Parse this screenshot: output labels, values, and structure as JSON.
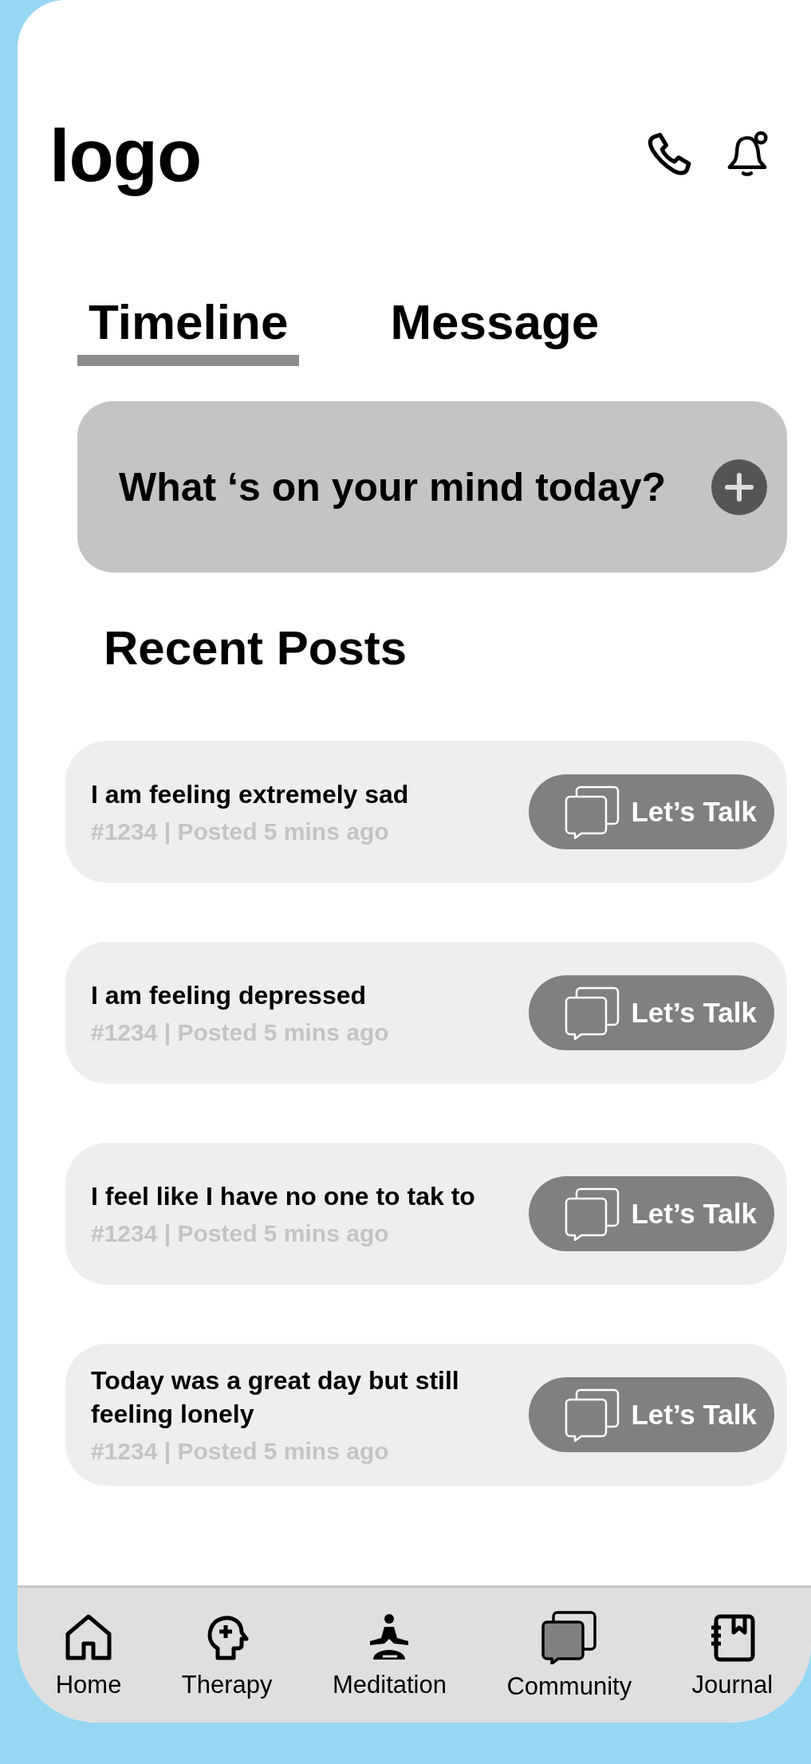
{
  "header": {
    "logo": "logo"
  },
  "tabs": [
    {
      "label": "Timeline",
      "selected": true
    },
    {
      "label": "Message",
      "selected": false
    }
  ],
  "composer": {
    "prompt": "What ‘s on your mind today?"
  },
  "recent_posts": {
    "title": "Recent Posts",
    "posts": [
      {
        "text": "I am feeling extremely sad",
        "meta": "#1234 | Posted 5 mins ago",
        "action": "Let’s Talk"
      },
      {
        "text": "I am feeling depressed",
        "meta": "#1234 | Posted 5 mins ago",
        "action": "Let’s Talk"
      },
      {
        "text": "I feel like I have no one to tak to",
        "meta": "#1234 | Posted 5 mins ago",
        "action": "Let’s Talk"
      },
      {
        "text": "Today was a great day but still feeling lonely",
        "meta": "#1234 | Posted 5 mins ago",
        "action": "Let’s Talk"
      }
    ]
  },
  "nav": [
    {
      "kind": "home",
      "label": "Home"
    },
    {
      "kind": "therapy",
      "label": "Therapy"
    },
    {
      "kind": "meditation",
      "label": "Meditation"
    },
    {
      "kind": "community",
      "label": "Community"
    },
    {
      "kind": "journal",
      "label": "Journal"
    }
  ]
}
